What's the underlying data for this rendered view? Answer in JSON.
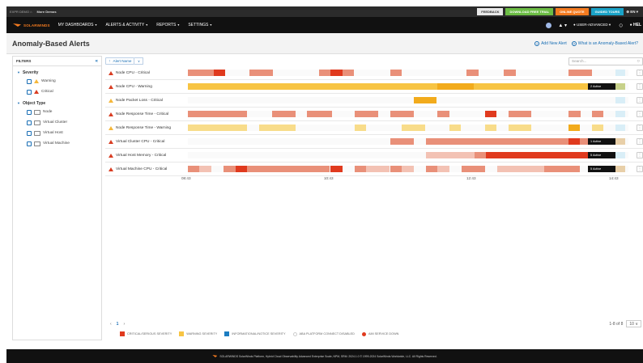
{
  "topbar": {
    "brand_small": "EXPR DEMO ⌂",
    "more_demos": "More Demos",
    "buttons": [
      "FEEDBACK",
      "DOWNLOAD FREE TRIAL",
      "ONLINE QUOTE",
      "GUIDED TOURS"
    ],
    "language": "⊕ EN ▾"
  },
  "navbar": {
    "logo_text": "SOLARWINDS",
    "items": [
      "MY DASHBOARDS",
      "ALERTS & ACTIVITY",
      "REPORTS",
      "SETTINGS"
    ],
    "user": "USER-ADVANCED ▾",
    "help": "HEL"
  },
  "page": {
    "title": "Anomaly-Based Alerts",
    "add_new_alert": "Add New Alert",
    "what_is": "What is an Anomaly-Based Alert?"
  },
  "filters": {
    "title": "FILTERS",
    "groups": [
      {
        "title": "Severity",
        "items": [
          "Warning",
          "Critical"
        ]
      },
      {
        "title": "Object Type",
        "items": [
          "Node",
          "Virtual Cluster",
          "Virtual Host",
          "Virtual Machine"
        ]
      }
    ]
  },
  "toolbar": {
    "sort_label": "Alert Name",
    "search_placeholder": "Search..."
  },
  "colors": {
    "critical": "#e03a1e",
    "critical_light": "#e99079",
    "critical_pale": "#f3c2b4",
    "warning": "#f7c443",
    "warning_dark": "#f2ab1c",
    "warning_pale": "#f8dc8a",
    "informational": "#1c7dc1",
    "tail_blue": "#d9eef7",
    "tail_olive": "#c7d18a",
    "tail_tan": "#e8cfa8"
  },
  "alerts": [
    {
      "name": "Node CPU - Critical",
      "severity": "critical",
      "active": "",
      "tail": "tail_blue"
    },
    {
      "name": "Node CPU - Warning",
      "severity": "critical",
      "active": "2 Active",
      "tail": "tail_olive"
    },
    {
      "name": "Node Packet Loss - Critical",
      "severity": "warning",
      "active": "",
      "tail": "tail_blue"
    },
    {
      "name": "Node Response Time - Critical",
      "severity": "critical",
      "active": "",
      "tail": "tail_blue"
    },
    {
      "name": "Node Response Time - Warning",
      "severity": "warning",
      "active": "",
      "tail": "tail_blue"
    },
    {
      "name": "Virtual Cluster CPU - Critical",
      "severity": "critical",
      "active": "1 Active",
      "tail": "tail_tan"
    },
    {
      "name": "Virtual Host Memory - Critical",
      "severity": "critical",
      "active": "5 Active",
      "tail": "tail_blue"
    },
    {
      "name": "Virtual Machine CPU - Critical",
      "severity": "critical",
      "active": "5 Active",
      "tail": "tail_tan"
    }
  ],
  "time_axis": [
    "08:43",
    "10:43",
    "12:43",
    "14:43"
  ],
  "pagination": {
    "prev": "‹",
    "page": "1",
    "next": "›",
    "count": "1-8 of 8",
    "page_size": "10 ∨"
  },
  "legend": [
    {
      "label": "CRITICAL/SERIOUS SEVERITY",
      "color": "#e03a1e",
      "kind": "square"
    },
    {
      "label": "WARNING SEVERITY",
      "color": "#f7c443",
      "kind": "square"
    },
    {
      "label": "INFORMATIONAL/NOTICE SEVERITY",
      "color": "#1c7dc1",
      "kind": "square"
    },
    {
      "label": "ABA PLATFORM CONNECT DISABLED",
      "color": "#cccccc",
      "kind": "ring"
    },
    {
      "label": "AIM SERVICE DOWN",
      "color": "#e03a1e",
      "kind": "dot"
    }
  ],
  "footer": {
    "text": "SOLARWINDS  SolarWinds Platform, Hybrid Cloud Observability Advanced Enterprise Scale, NPM, SRM: 2024.1.0 © 1999-2024 SolarWinds Worldwide, LLC. All Rights Reserved."
  }
}
